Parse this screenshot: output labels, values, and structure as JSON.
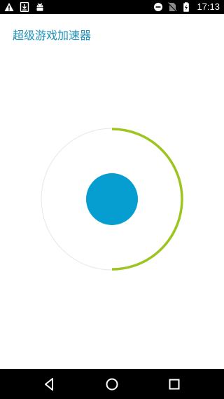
{
  "status_bar": {
    "time": "17:13",
    "left_icons": [
      "warning-icon",
      "download-icon",
      "android-icon"
    ],
    "right_icons": [
      "do-not-disturb-icon",
      "no-sim-icon",
      "battery-charging-icon"
    ]
  },
  "app": {
    "title": "超级游戏加速器"
  },
  "accelerator": {
    "progress": 0.5,
    "ring_track_color": "#e6e6e6",
    "ring_progress_color": "#9dc41f",
    "button_color": "#069ed1"
  },
  "nav_bar": {
    "buttons": [
      "back-icon",
      "home-icon",
      "recents-icon"
    ]
  }
}
